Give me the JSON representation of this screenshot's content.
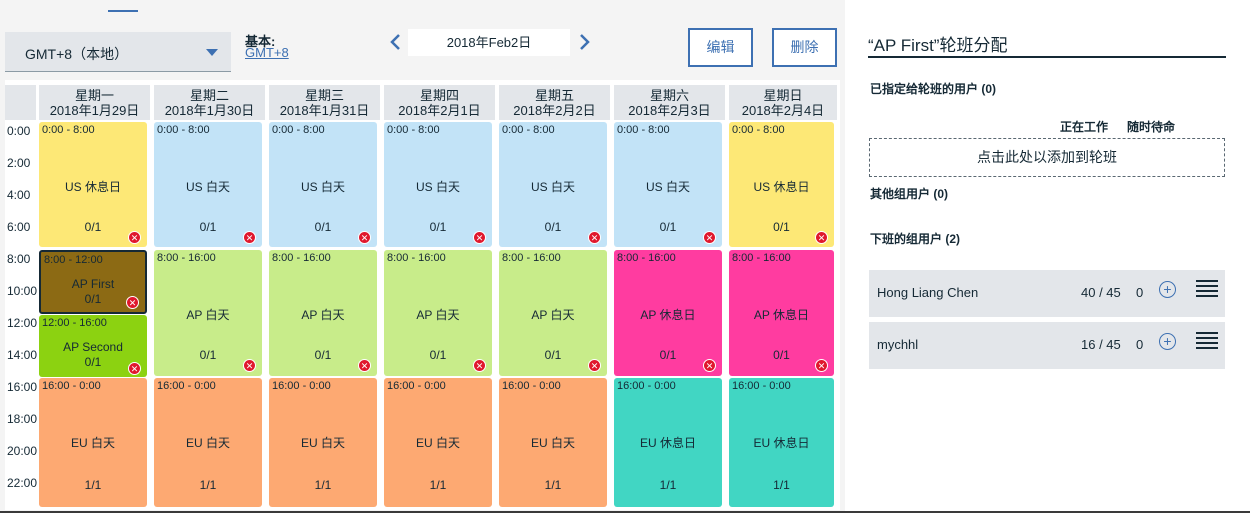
{
  "toolbar": {
    "timezone": "GMT+8（本地）",
    "base_label": "基本:",
    "base_link": "GMT+8",
    "date": "2018年Feb2日",
    "edit_label": "编辑",
    "delete_label": "删除"
  },
  "times": [
    "0:00",
    "2:00",
    "4:00",
    "6:00",
    "8:00",
    "10:00",
    "12:00",
    "14:00",
    "16:00",
    "18:00",
    "20:00",
    "22:00"
  ],
  "days": [
    {
      "weekday": "星期一",
      "date": "2018年1月29日"
    },
    {
      "weekday": "星期二",
      "date": "2018年1月30日"
    },
    {
      "weekday": "星期三",
      "date": "2018年1月31日"
    },
    {
      "weekday": "星期四",
      "date": "2018年2月1日"
    },
    {
      "weekday": "星期五",
      "date": "2018年2月2日"
    },
    {
      "weekday": "星期六",
      "date": "2018年2月3日"
    },
    {
      "weekday": "星期日",
      "date": "2018年2月4日"
    }
  ],
  "shifts": {
    "mon": [
      {
        "time": "0:00 - 8:00",
        "label": "US 休息日",
        "count": "0/1"
      },
      {
        "time": "8:00 - 12:00",
        "label": "AP First",
        "count": "0/1"
      },
      {
        "time": "12:00 - 16:00",
        "label": "AP Second",
        "count": "0/1"
      },
      {
        "time": "16:00 - 0:00",
        "label": "EU 白天",
        "count": "1/1"
      }
    ],
    "tue": [
      {
        "time": "0:00 - 8:00",
        "label": "US 白天",
        "count": "0/1"
      },
      {
        "time": "8:00 - 16:00",
        "label": "AP 白天",
        "count": "0/1"
      },
      {
        "time": "16:00 - 0:00",
        "label": "EU 白天",
        "count": "1/1"
      }
    ],
    "wed": [
      {
        "time": "0:00 - 8:00",
        "label": "US 白天",
        "count": "0/1"
      },
      {
        "time": "8:00 - 16:00",
        "label": "AP 白天",
        "count": "0/1"
      },
      {
        "time": "16:00 - 0:00",
        "label": "EU 白天",
        "count": "1/1"
      }
    ],
    "thu": [
      {
        "time": "0:00 - 8:00",
        "label": "US 白天",
        "count": "0/1"
      },
      {
        "time": "8:00 - 16:00",
        "label": "AP 白天",
        "count": "0/1"
      },
      {
        "time": "16:00 - 0:00",
        "label": "EU 白天",
        "count": "1/1"
      }
    ],
    "fri": [
      {
        "time": "0:00 - 8:00",
        "label": "US 白天",
        "count": "0/1"
      },
      {
        "time": "8:00 - 16:00",
        "label": "AP 白天",
        "count": "0/1"
      },
      {
        "time": "16:00 - 0:00",
        "label": "EU 白天",
        "count": "1/1"
      }
    ],
    "sat": [
      {
        "time": "0:00 - 8:00",
        "label": "US 白天",
        "count": "0/1"
      },
      {
        "time": "8:00 - 16:00",
        "label": "AP 休息日",
        "count": "0/1"
      },
      {
        "time": "16:00 - 0:00",
        "label": "EU 休息日",
        "count": "1/1"
      }
    ],
    "sun": [
      {
        "time": "0:00 - 8:00",
        "label": "US 休息日",
        "count": "0/1"
      },
      {
        "time": "8:00 - 16:00",
        "label": "AP 休息日",
        "count": "0/1"
      },
      {
        "time": "16:00 - 0:00",
        "label": "EU 休息日",
        "count": "1/1"
      }
    ]
  },
  "colors": {
    "us_weekday": "#c2e3f7",
    "us_weekend": "#fde876",
    "ap_weekday": "#c8ec8a",
    "ap_weekend": "#ff3ca0",
    "ap_first": "#8c6a14",
    "ap_second": "#8cd211",
    "eu_weekday": "#fda972",
    "eu_weekend": "#41d6c3",
    "accent": "#3d70b2",
    "delete": "#e0182d"
  },
  "panel": {
    "title": "“AP First”轮班分配",
    "assigned_heading": "已指定给轮班的用户 (0)",
    "col_working": "正在工作",
    "col_oncall": "随时待命",
    "dropzone": "点击此处以添加到轮班",
    "others_heading": "其他组用户 (0)",
    "offduty_heading": "下班的组用户 (2)",
    "users": [
      {
        "name": "Hong Liang Chen",
        "hours": "40 / 45",
        "oncall": "0"
      },
      {
        "name": "mychhl",
        "hours": "16 / 45",
        "oncall": "0"
      }
    ]
  }
}
